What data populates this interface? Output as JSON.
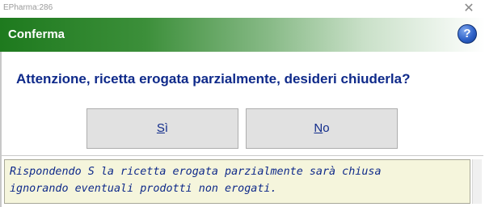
{
  "window": {
    "app_title": "EPharma:286",
    "close_glyph": "✕"
  },
  "header": {
    "title": "Conferma",
    "help_icon": "question-mark-icon",
    "help_glyph": "?",
    "gradient_start": "#1e7a1e",
    "gradient_end": "#ffffff"
  },
  "dialog": {
    "question": "Attenzione, ricetta erogata parzialmente, desideri chiuderla?",
    "yes_label_mnemonic": "S",
    "yes_label_rest": "ì",
    "no_label_mnemonic": "N",
    "no_label_rest": "o",
    "text_color": "#0f2a8a"
  },
  "info": {
    "line1": "Rispondendo S la ricetta erogata parzialmente sarà chiusa",
    "line2": "ignorando eventuali prodotti non erogati.",
    "background": "#f5f5dc"
  }
}
